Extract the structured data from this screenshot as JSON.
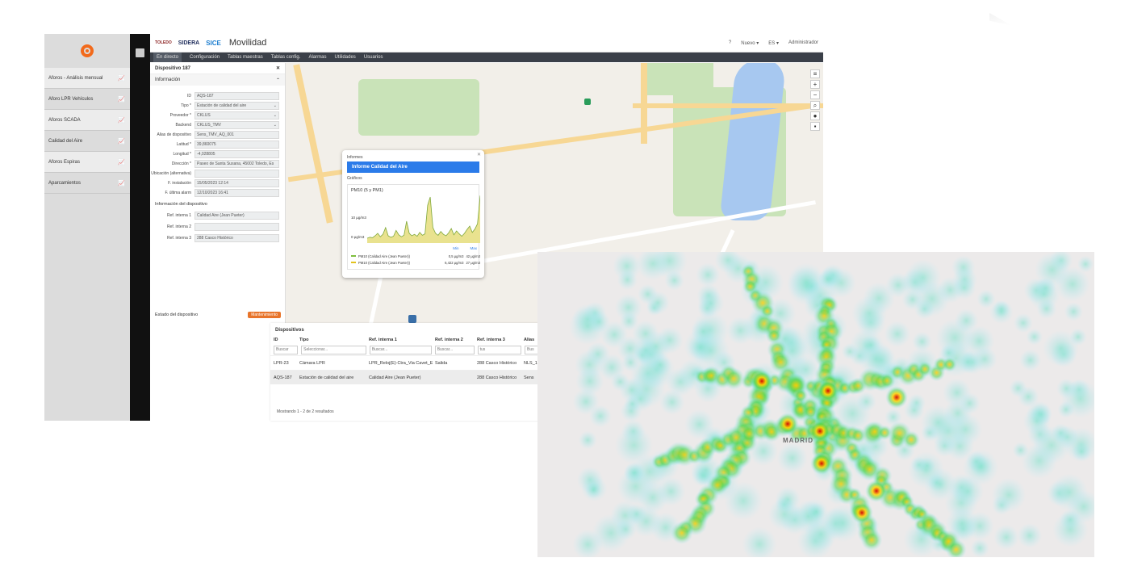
{
  "grafana": {
    "menu": [
      {
        "label": "Aforos - Análisis mensual"
      },
      {
        "label": "Aforo LPR Vehículos"
      },
      {
        "label": "Aforos SCADA"
      },
      {
        "label": "Calidad del Aire"
      },
      {
        "label": "Aforos Espiras"
      },
      {
        "label": "Aparcamientos"
      }
    ]
  },
  "header": {
    "logo1": "TOLEDO",
    "logo2": "SIDERA",
    "logo3": "SICE",
    "title": "Movilidad",
    "help": "?",
    "lang": "Nuevo ▾",
    "flag": "ES ▾",
    "user": "Administrador"
  },
  "nav": [
    "En directo",
    "Configuración",
    "Tablas maestras",
    "Tablas config.",
    "Alarmas",
    "Utilidades",
    "Usuarios"
  ],
  "device": {
    "title": "Dispositivo 187",
    "section": "Información",
    "fields": [
      {
        "label": "ID",
        "value": "AQS-187"
      },
      {
        "label": "Tipo *",
        "value": "Estación de calidad del aire"
      },
      {
        "label": "Proveedor *",
        "value": "CKLUS"
      },
      {
        "label": "Backend",
        "value": "CKLUS_TMV"
      },
      {
        "label": "Alias de dispositivo",
        "value": "Sens_TMV_AQ_001"
      },
      {
        "label": "Latitud *",
        "value": "39,860075"
      },
      {
        "label": "Longitud *",
        "value": "-4,028805"
      },
      {
        "label": "Dirección *",
        "value": "Paseo de Santa Susana, 45002 Toledo, Es"
      },
      {
        "label": "Ubicación (alternativa)",
        "value": ""
      },
      {
        "label": "F. instalación",
        "value": "15/05/2023 12:14"
      },
      {
        "label": "F. última alarm",
        "value": "12/10/2023 16:41"
      }
    ],
    "sub": "Información del dispositivo",
    "refs": [
      {
        "label": "Ref. interna 1",
        "value": "Calidad Aire (Jean Pueter)"
      },
      {
        "label": "Ref. interna 2",
        "value": ""
      },
      {
        "label": "Ref. interna 3",
        "value": "288 Casco Histórico"
      }
    ],
    "status_label": "Estado del dispositivo",
    "status_badge": "Mantenimiento"
  },
  "popup": {
    "section": "Informes",
    "button": "Informe Calidad del Aire",
    "subsection": "Gráficos",
    "chart_title": "PM10 (5 y PM1)",
    "ylabels": [
      "10 µg/m3",
      "0 µg/m3"
    ],
    "legend": [
      {
        "name": "PM10 (Calidad Aire (Jean Pueter))",
        "v1": "0,5 µg/m3",
        "v2": "42 µg/m3",
        "color": "#7fbf3f"
      },
      {
        "name": "PM10 (Calidad Aire (Jean Pueter))",
        "v1": "6,422 µg/m3",
        "v2": "27 µg/m3",
        "color": "#e3c21d"
      }
    ],
    "minmax": [
      "Min",
      "Max"
    ],
    "chart_data": {
      "type": "area",
      "series": [
        {
          "values": [
            1,
            1.2,
            1.1,
            1.5,
            2,
            1.3,
            1.8,
            3.2,
            1.5,
            1.2,
            1.4,
            2.6,
            1.7,
            1.3,
            1.6,
            4.5,
            2,
            1.5,
            1.8,
            1.4,
            2.2,
            1.6,
            1.9,
            7.8,
            9.5,
            3.2,
            2,
            1.6,
            2.4,
            1.8,
            1.5,
            2.1,
            3,
            1.7,
            2.5,
            1.9,
            1.4,
            2,
            2.8,
            3.5,
            2.2,
            2.9,
            4,
            9.8
          ]
        }
      ]
    }
  },
  "devtable": {
    "title": "Dispositivos",
    "headers": [
      "ID",
      "Tipo",
      "Ref. interna 1",
      "Ref. interna 2",
      "Ref. interna 3",
      "Alias"
    ],
    "filters": [
      "Buscar",
      "Seleccionar...",
      "Buscar...",
      "Buscar...",
      "tus",
      "Bus"
    ],
    "rows": [
      [
        "LPR-23",
        "Cámara LPR",
        "LPR_Reloj(E)-Ctra_Via Cavet_E",
        "Salida",
        "288 Casco Histórico",
        "NLS_1"
      ],
      [
        "AQS-187",
        "Estación de calidad del aire",
        "Calidad Aire (Jean Pueter)",
        "",
        "288 Casco Histórico",
        "Sens"
      ]
    ],
    "footer": "Mostrando 1 - 2 de 2 resultados"
  },
  "heatmap": {
    "city": "MADRID"
  }
}
